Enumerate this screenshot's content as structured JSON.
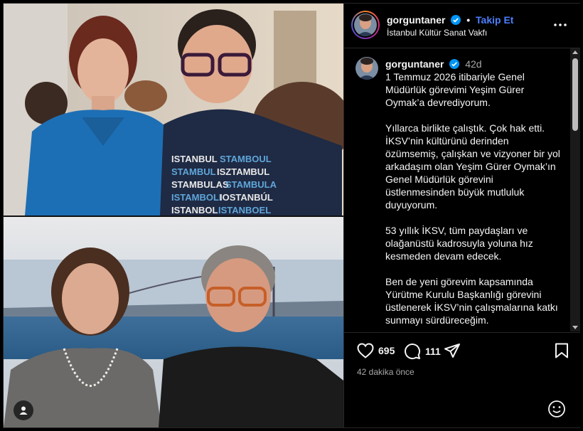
{
  "post": {
    "username": "gorguntaner",
    "follow_label": "Takip Et",
    "location": "İstanbul Kültür Sanat Vakfı",
    "time_ago": "42d",
    "caption": [
      "1 Temmuz 2026 itibariyle Genel Müdürlük görevimi Yeşim Gürer Oymak’a devrediyorum.",
      "Yıllarca birlikte çalıştık. Çok hak etti. İKSV’nin kültürünü derinden özümsemiş, çalışkan ve vizyoner bir yol arkadaşım olan Yeşim Gürer Oymak’ın Genel Müdürlük görevini üstlenmesinden büyük mutluluk duyuyorum.",
      "53 yıllık İKSV, tüm paydaşları ve olağanüstü kadrosuyla yoluna hız kesmeden devam edecek.",
      "Ben de yeni görevim kapsamında Yürütme Kurulu Başkanlığı görevini üstlenerek İKSV’nin çalışmalarına katkı sunmayı sürdüreceğim."
    ],
    "likes": "695",
    "comments": "111",
    "posted": "42 dakika önce"
  },
  "shirt_text": [
    "ISTANBUL STAMBOUL",
    "STAMBUL ISZTAMBUL",
    "STAMBULAS STAMBULA",
    "ISTAMBOLI IOSTANBÚL",
    "ISTANBOL ISTANBOEL"
  ],
  "colors": {
    "accent": "#4c7eff",
    "verified": "#0095f6",
    "background": "#000000"
  }
}
